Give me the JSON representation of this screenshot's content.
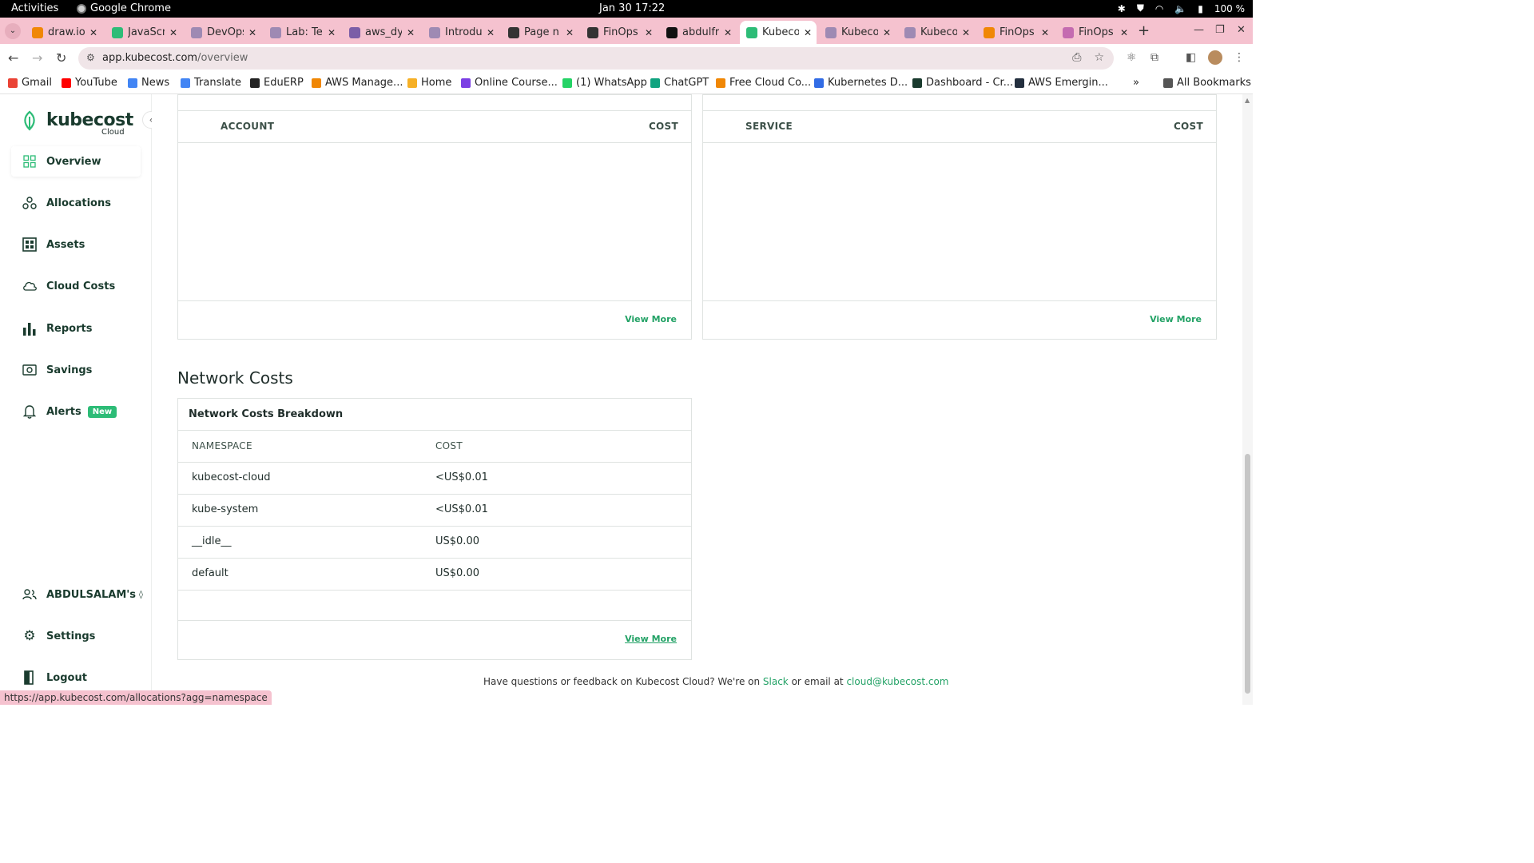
{
  "system": {
    "activities": "Activities",
    "app_name": "Google Chrome",
    "clock": "Jan 30  17:22",
    "battery": "100 %"
  },
  "tabs": [
    {
      "title": "draw.io",
      "color": "#f08705"
    },
    {
      "title": "JavaScr",
      "color": "#2dbc77"
    },
    {
      "title": "DevOps",
      "color": "#9e8ab3"
    },
    {
      "title": "Lab: Te",
      "color": "#9e8ab3"
    },
    {
      "title": "aws_dy",
      "color": "#7b5ea7"
    },
    {
      "title": "Introdu",
      "color": "#9e8ab3"
    },
    {
      "title": "Page n",
      "color": "#333333"
    },
    {
      "title": "FinOps",
      "color": "#333333"
    },
    {
      "title": "abdulfr",
      "color": "#111111"
    },
    {
      "title": "Kubeco",
      "color": "#2dbc77"
    },
    {
      "title": "Kubeco",
      "color": "#9e8ab3"
    },
    {
      "title": "Kubeco",
      "color": "#9e8ab3"
    },
    {
      "title": "FinOps",
      "color": "#f08705"
    },
    {
      "title": "FinOps",
      "color": "#c46bb0"
    }
  ],
  "address": {
    "domain": "app.kubecost.com",
    "path": "/overview"
  },
  "bookmarks": [
    {
      "label": "Gmail",
      "color": "#ea4335"
    },
    {
      "label": "YouTube",
      "color": "#ff0000"
    },
    {
      "label": "News",
      "color": "#4285f4"
    },
    {
      "label": "Translate",
      "color": "#4285f4"
    },
    {
      "label": "EduERP",
      "color": "#222222"
    },
    {
      "label": "AWS Manage...",
      "color": "#f08705"
    },
    {
      "label": "Home",
      "color": "#f6b026"
    },
    {
      "label": "Online Course...",
      "color": "#7b3fe4"
    },
    {
      "label": "(1) WhatsApp",
      "color": "#25d366"
    },
    {
      "label": "ChatGPT",
      "color": "#10a37f"
    },
    {
      "label": "Free Cloud Co...",
      "color": "#f08705"
    },
    {
      "label": "Kubernetes D...",
      "color": "#326ce5"
    },
    {
      "label": "Dashboard - Cr...",
      "color": "#1a3b2e"
    },
    {
      "label": "AWS Emergin...",
      "color": "#232f3e"
    },
    {
      "label": "All Bookmarks",
      "color": "#555555"
    }
  ],
  "sidebar": {
    "brand": "kubecost",
    "brand_sub": "Cloud",
    "items": [
      {
        "label": "Overview"
      },
      {
        "label": "Allocations"
      },
      {
        "label": "Assets"
      },
      {
        "label": "Cloud Costs"
      },
      {
        "label": "Reports"
      },
      {
        "label": "Savings"
      },
      {
        "label": "Alerts",
        "badge": "New"
      }
    ],
    "account": "ABDULSALAM's",
    "settings": "Settings",
    "logout": "Logout"
  },
  "account_breakdown": {
    "col_account": "ACCOUNT",
    "col_cost": "COST",
    "view_more": "View More"
  },
  "service_breakdown": {
    "col_service": "SERVICE",
    "col_cost": "COST",
    "view_more": "View More"
  },
  "network": {
    "section_title": "Network Costs",
    "card_title": "Network Costs Breakdown",
    "col_namespace": "NAMESPACE",
    "col_cost": "COST",
    "rows": [
      {
        "namespace": "kubecost-cloud",
        "cost": "<US$0.01"
      },
      {
        "namespace": "kube-system",
        "cost": "<US$0.01"
      },
      {
        "namespace": "__idle__",
        "cost": "US$0.00"
      },
      {
        "namespace": "default",
        "cost": "US$0.00"
      }
    ],
    "view_more": "View More"
  },
  "footer": {
    "text_1": "Have questions or feedback on Kubecost Cloud? We're on ",
    "slack": "Slack",
    "text_2": " or email at ",
    "email": "cloud@kubecost.com"
  },
  "status_url": "https://app.kubecost.com/allocations?agg=namespace",
  "colors": {
    "accent": "#2dbc77",
    "link": "#23a266",
    "tabstrip": "#f5c2cf",
    "brand_dark": "#1a3b2e"
  }
}
